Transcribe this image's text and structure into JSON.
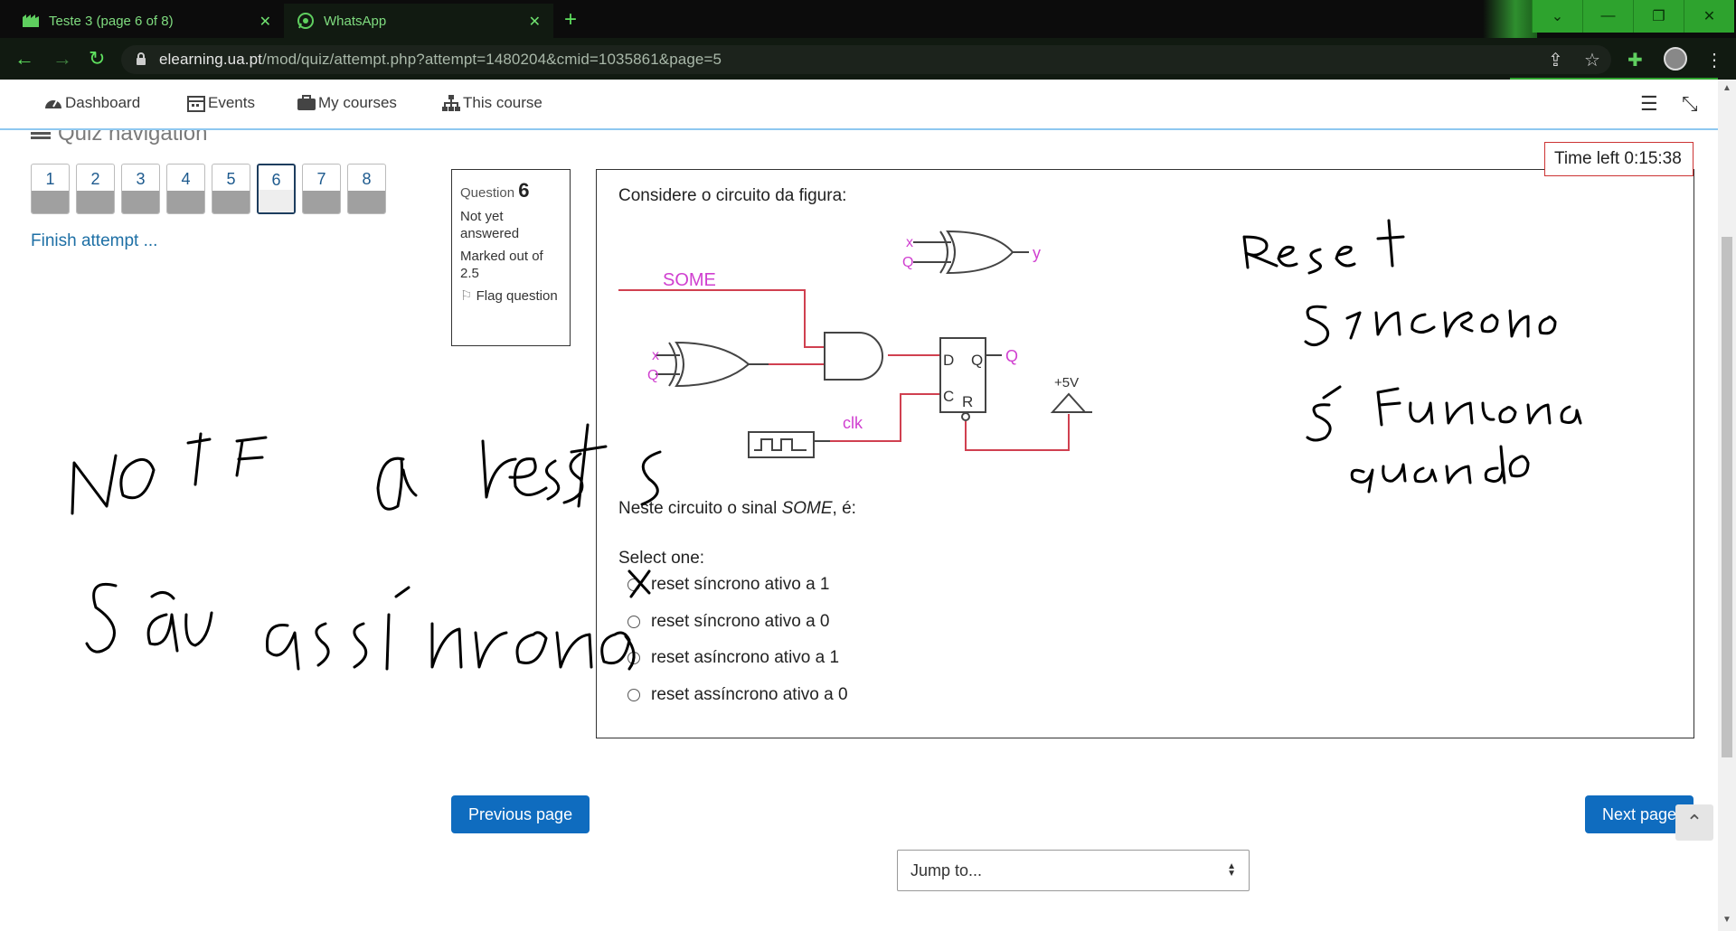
{
  "browser": {
    "tabs": [
      {
        "title": "Teste 3 (page 6 of 8)",
        "icon": "moodle-icon",
        "active": false
      },
      {
        "title": "WhatsApp",
        "icon": "whatsapp-icon",
        "active": true
      }
    ],
    "url_host": "elearning.ua.pt",
    "url_path": "/mod/quiz/attempt.php?attempt=1480204&cmid=1035861&page=5",
    "accent": "#2ea32e"
  },
  "topnav": {
    "items": [
      {
        "label": "Dashboard",
        "icon": "dashboard-icon"
      },
      {
        "label": "Events",
        "icon": "calendar-icon"
      },
      {
        "label": "My courses",
        "icon": "briefcase-icon"
      },
      {
        "label": "This course",
        "icon": "sitemap-icon"
      }
    ]
  },
  "quiz_nav": {
    "title": "Quiz navigation",
    "pages": [
      "1",
      "2",
      "3",
      "4",
      "5",
      "6",
      "7",
      "8"
    ],
    "current": "6",
    "finish_label": "Finish attempt ..."
  },
  "question": {
    "label": "Question",
    "number": "6",
    "status": "Not yet answered",
    "marked": "Marked out of 2.5",
    "flag": "Flag question",
    "timer": "Time left 0:15:38",
    "text": "Considere o circuito da figura:",
    "prompt_pre": "Neste circuito o sinal ",
    "prompt_signal": "SOME",
    "prompt_post": ", é:",
    "select_label": "Select one:",
    "options": [
      "reset síncrono ativo a 1",
      "reset síncrono ativo a 0",
      "reset asíncrono ativo a 1",
      "reset assíncrono ativo a 0"
    ]
  },
  "circuit_labels": {
    "x": "x",
    "q": "Q",
    "y": "y",
    "some": "SOME",
    "d": "D",
    "c": "C",
    "r": "R",
    "qout": "Q",
    "clk": "clk",
    "vcc": "+5V"
  },
  "buttons": {
    "previous": "Previous page",
    "next": "Next page",
    "jump": "Jump to..."
  }
}
